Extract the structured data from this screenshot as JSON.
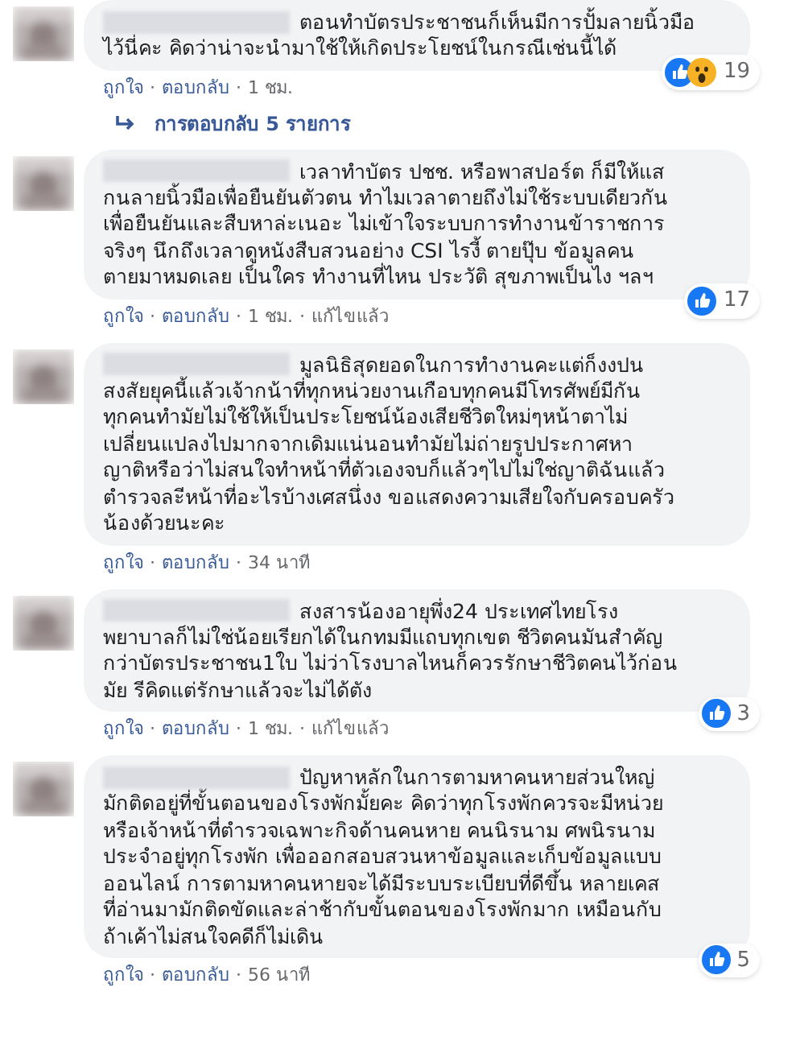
{
  "separator": "·",
  "comments": [
    {
      "text_lines": [
        "ตอนทำบัตรประชาชนก็เห็นมีการปั้มลายนิ้วมือ",
        "ไว้นี่คะ คิดว่าน่าจะนำมาใช้ให้เกิดประโยชน์ในกรณีเช่นนี้ได้"
      ],
      "reactions": [
        {
          "kind": "like"
        },
        {
          "kind": "wow"
        }
      ],
      "reaction_count": "19",
      "actions": [
        {
          "kind": "link",
          "text": "ถูกใจ"
        },
        {
          "kind": "link",
          "text": "ตอบกลับ"
        },
        {
          "kind": "time",
          "text": "1 ชม."
        }
      ],
      "replies": "การตอบกลับ 5 รายการ"
    },
    {
      "text_lines": [
        "เวลาทำบัตร ปชช. หรือพาสปอร์ต ก็มีให้แส",
        "กนลายนิ้วมือเพื่อยืนยันตัวตน ทำไมเวลาตายถึงไม่ใช้ระบบเดียวกัน",
        "เพื่อยืนยันและสืบหาล่ะเนอะ ไม่เข้าใจระบบการทำงานข้าราชการ",
        "จริงๆ นึกถึงเวลาดูหนังสืบสวนอย่าง CSI ไรงี้ ตายปุ๊บ ข้อมูลคน",
        "ตายมาหมดเลย เป็นใคร ทำงานที่ไหน ประวัติ สุขภาพเป็นไง ฯลฯ"
      ],
      "reactions": [
        {
          "kind": "like"
        }
      ],
      "reaction_count": "17",
      "actions": [
        {
          "kind": "link",
          "text": "ถูกใจ"
        },
        {
          "kind": "link",
          "text": "ตอบกลับ"
        },
        {
          "kind": "time",
          "text": "1 ชม."
        },
        {
          "kind": "edited",
          "text": "แก้ไขแล้ว"
        }
      ]
    },
    {
      "text_lines": [
        "มูลนิธิสุดยอดในการทำงานคะแต่ก็งงปน",
        "สงสัยยุคนี้แล้วเจ้ากน้าที่ทุกหน่วยงานเกือบทุกคนมีโทรศัพย์มีกัน",
        "ทุกคนทำมัยไม่ใช้ให้เป็นประโยชน์น้องเสียชีวิตใหม่ๆหน้าตาไม่",
        "เปลี่ยนแปลงไปมากจากเดิมแน่นอนทำมัยไม่ถ่ายรูปประกาศหา",
        "ญาติหรือว่าไม่สนใจทำหน้าที่ตัวเองจบก็แล้วๆไปไม่ใช่ญาติฉันแล้ว",
        "ตำรวจละีหน้าที่อะไรบ้างเศสนึ่งง ขอแสดงความเสียใจกับครอบครัว",
        "น้องด้วยนะคะ"
      ],
      "actions": [
        {
          "kind": "link",
          "text": "ถูกใจ"
        },
        {
          "kind": "link",
          "text": "ตอบกลับ"
        },
        {
          "kind": "time",
          "text": "34 นาที"
        }
      ]
    },
    {
      "text_lines": [
        "สงสารน้องอายุพึ่ง24 ประเทศไทยโรง",
        "พยาบาลก็ไม่ใช่น้อยเรียกได้ในกทมมีแถบทุกเขต ชีวิตคนมันสำคัญ",
        "กว่าบัตรประชาชน1ใบ ไม่ว่าโรงบาลไหนก็ควรรักษาชีวิตคนไว้ก่อน",
        "มัย รีคิดแต่รักษาแล้วจะไม่ได้ตัง"
      ],
      "reactions": [
        {
          "kind": "like"
        }
      ],
      "reaction_count": "3",
      "actions": [
        {
          "kind": "link",
          "text": "ถูกใจ"
        },
        {
          "kind": "link",
          "text": "ตอบกลับ"
        },
        {
          "kind": "time",
          "text": "1 ชม."
        },
        {
          "kind": "edited",
          "text": "แก้ไขแล้ว"
        }
      ]
    },
    {
      "text_lines": [
        "ปัญหาหลักในการตามหาคนหายส่วนใหญ่",
        "มักติดอยู่ที่ขั้นตอนของโรงพักมั้ยคะ คิดว่าทุกโรงพักควรจะมีหน่วย",
        "หรือเจ้าหน้าที่ตำรวจเฉพาะกิจด้านคนหาย คนนิรนาม ศพนิรนาม",
        "ประจำอยู่ทุกโรงพัก เพื่อออกสอบสวนหาข้อมูลและเก็บข้อมูลแบบ",
        "ออนไลน์ การตามหาคนหายจะได้มีระบบระเบียบที่ดีขึ้น หลายเคส",
        "ที่อ่านมามักติดขัดและล่าช้ากับขั้นตอนของโรงพักมาก เหมือนกับ",
        "ถ้าเค้าไม่สนใจคดีก็ไม่เดิน"
      ],
      "reactions": [
        {
          "kind": "like"
        }
      ],
      "reaction_count": "5",
      "actions": [
        {
          "kind": "link",
          "text": "ถูกใจ"
        },
        {
          "kind": "link",
          "text": "ตอบกลับ"
        },
        {
          "kind": "time",
          "text": "56 นาที"
        }
      ]
    }
  ]
}
